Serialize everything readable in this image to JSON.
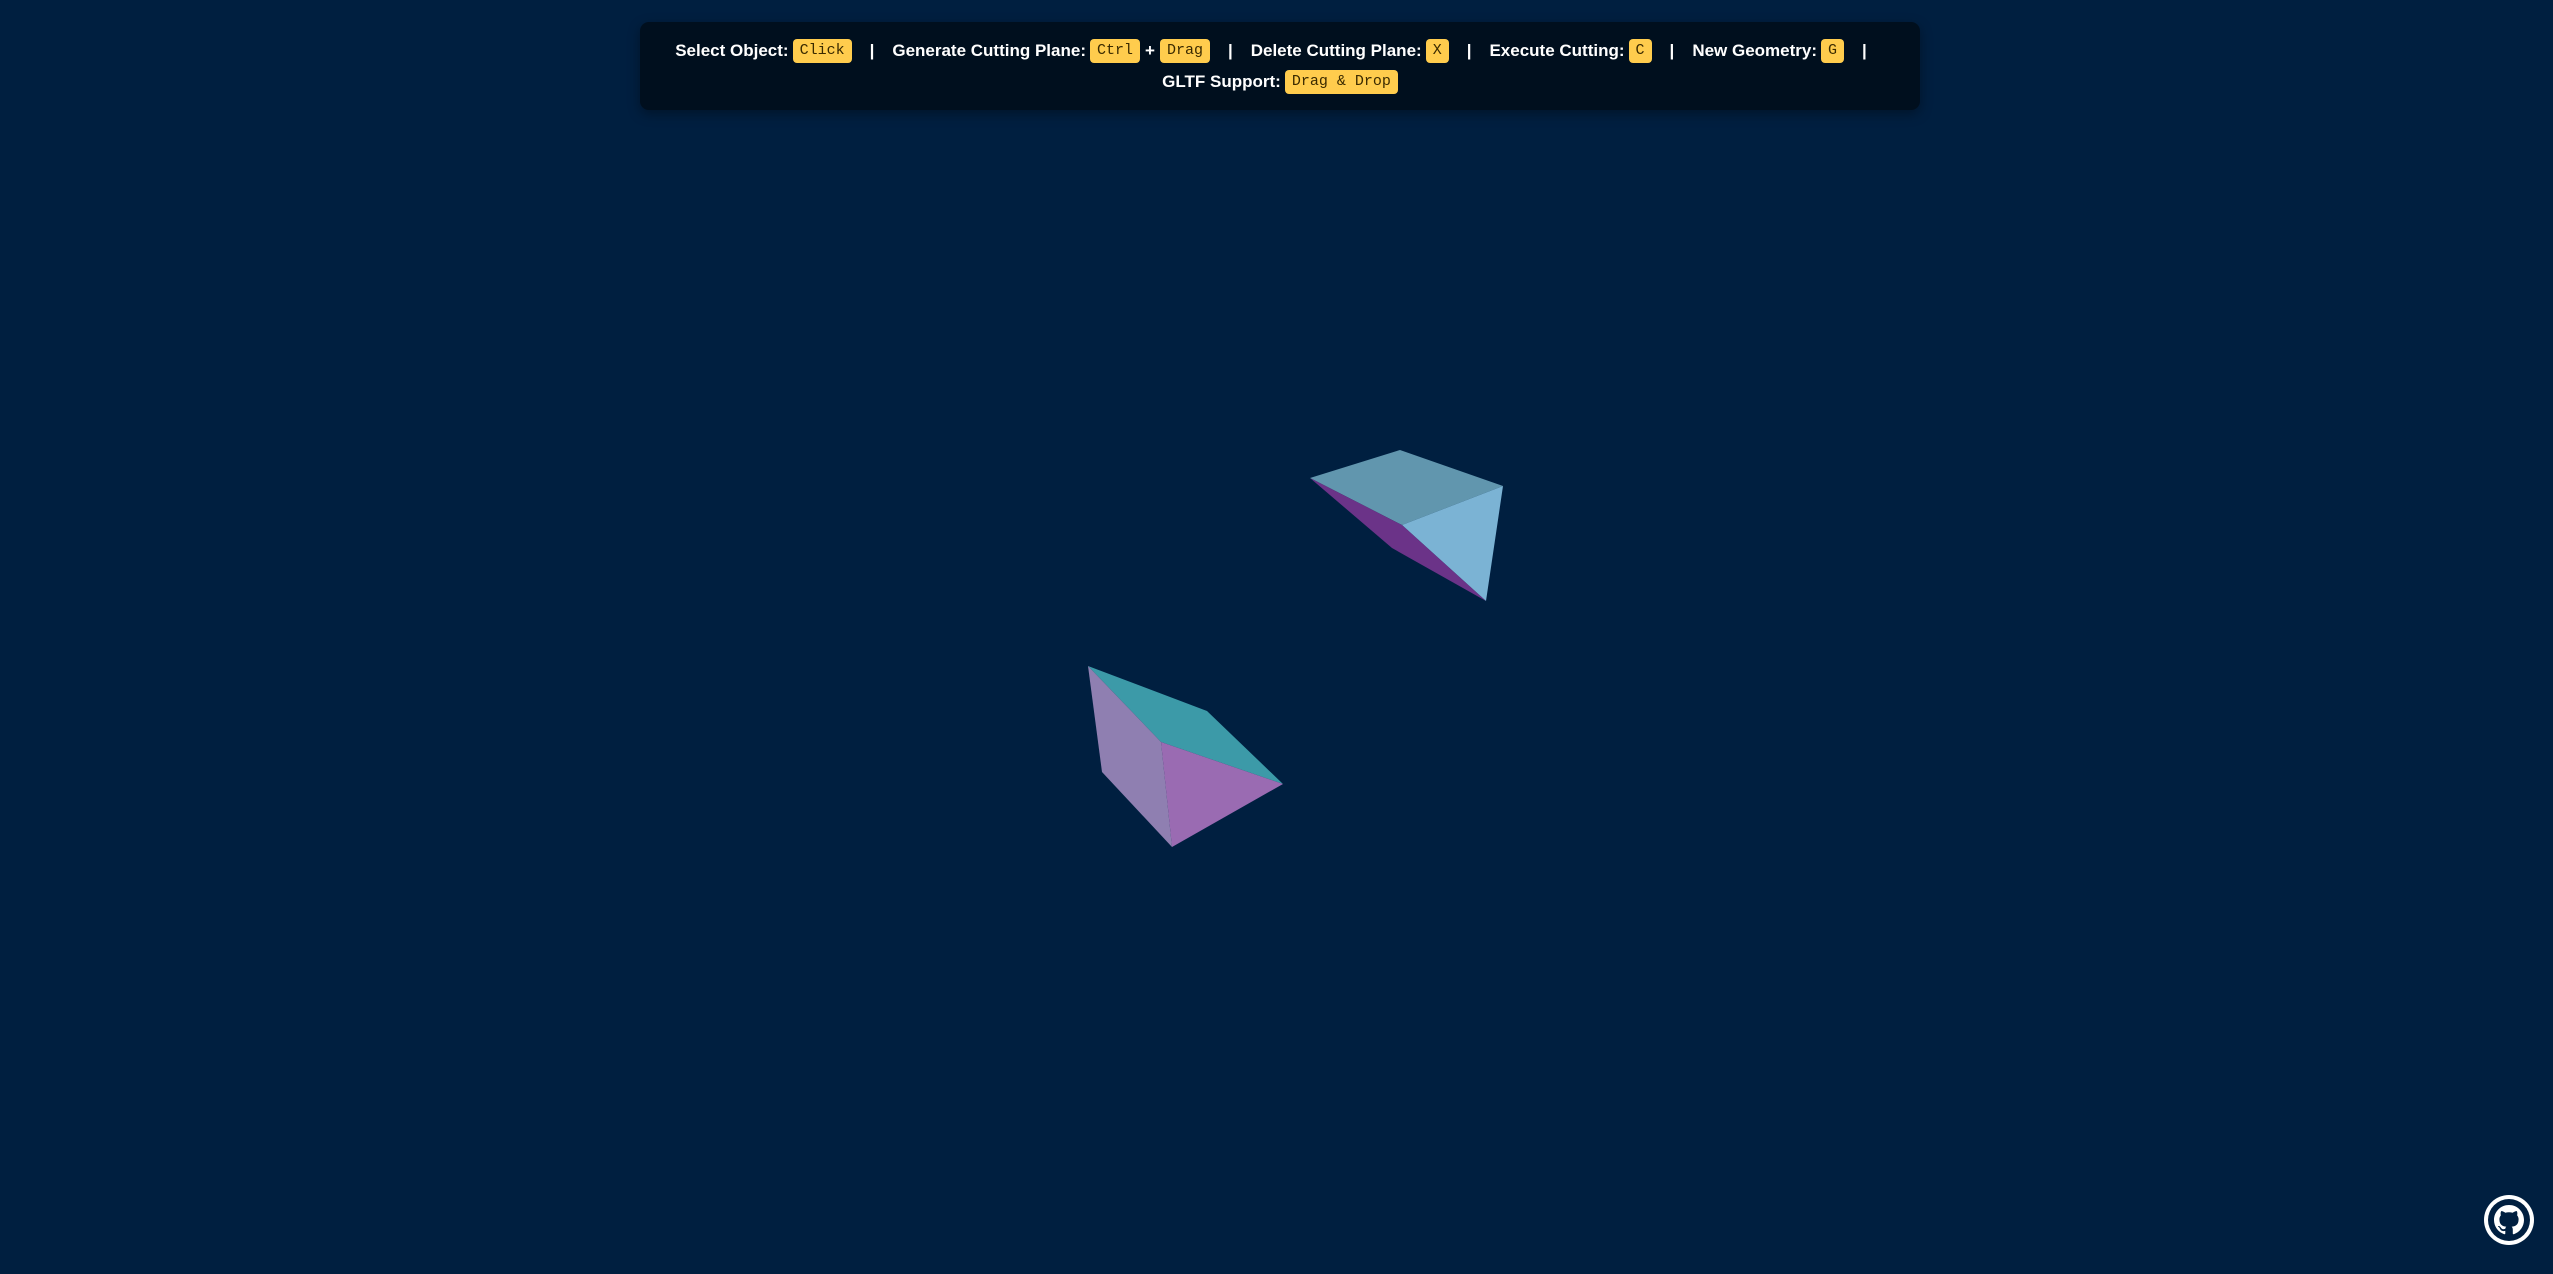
{
  "help": {
    "row1": [
      {
        "label": "Select Object:",
        "keys": [
          "Click"
        ]
      },
      {
        "label": "Generate Cutting Plane:",
        "keys": [
          "Ctrl",
          "Drag"
        ]
      },
      {
        "label": "Delete Cutting Plane:",
        "keys": [
          "X"
        ]
      },
      {
        "label": "Execute Cutting:",
        "keys": [
          "C"
        ]
      },
      {
        "label": "New Geometry:",
        "keys": [
          "G"
        ]
      }
    ],
    "row2": [
      {
        "label": "GLTF Support:",
        "keys": [
          "Drag & Drop"
        ]
      }
    ],
    "separator": "|",
    "plus": "+"
  },
  "scene": {
    "background": "#001f40",
    "objects": [
      {
        "name": "cut-piece-upper",
        "face_colors": [
          "#6196ae",
          "#7bb3d4",
          "#6b3388"
        ]
      },
      {
        "name": "cut-piece-lower",
        "face_colors": [
          "#3c9aa8",
          "#9a6bb2",
          "#8f7fb1"
        ]
      }
    ]
  },
  "github_icon": "github-icon",
  "colors": {
    "key_badge": "#ffcc4d",
    "help_bar": "#000f1e"
  }
}
